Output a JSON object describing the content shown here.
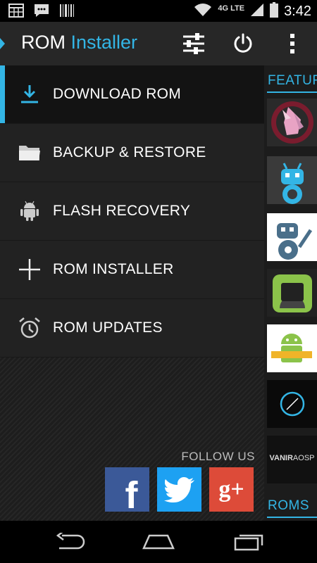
{
  "status_bar": {
    "time": "3:42",
    "network": "4G LTE",
    "icons": [
      "calendar-icon",
      "chat-icon",
      "barcode-icon",
      "wifi-icon",
      "signal-icon",
      "battery-icon"
    ]
  },
  "action_bar": {
    "title_part1": "ROM",
    "title_part2": " Installer",
    "actions": [
      "settings-sliders-icon",
      "power-icon",
      "overflow-menu-icon"
    ]
  },
  "drawer": {
    "items": [
      {
        "label": "DOWNLOAD ROM",
        "icon": "download-icon",
        "active": true
      },
      {
        "label": "BACKUP & RESTORE",
        "icon": "folder-icon",
        "active": false
      },
      {
        "label": "FLASH RECOVERY",
        "icon": "android-icon",
        "active": false
      },
      {
        "label": "ROM INSTALLER",
        "icon": "plus-icon",
        "active": false
      },
      {
        "label": "ROM UPDATES",
        "icon": "alarm-clock-icon",
        "active": false
      }
    ],
    "follow_label": "FOLLOW US",
    "social": [
      {
        "name": "facebook",
        "color": "#3b5998",
        "glyph": "f"
      },
      {
        "name": "twitter",
        "color": "#1da1f2"
      },
      {
        "name": "google-plus",
        "color": "#dd4b39",
        "glyph": "g+"
      }
    ]
  },
  "content_peek": {
    "featured_heading": "FEATURED",
    "roms_heading": "ROMS",
    "thumbnail_texts": [
      "VANIR",
      "AOSP"
    ]
  },
  "nav_bar": {
    "buttons": [
      "back-icon",
      "home-icon",
      "recents-icon"
    ]
  },
  "colors": {
    "accent": "#33b5e5",
    "actionbar": "#272727",
    "menu_bg": "#222222"
  }
}
